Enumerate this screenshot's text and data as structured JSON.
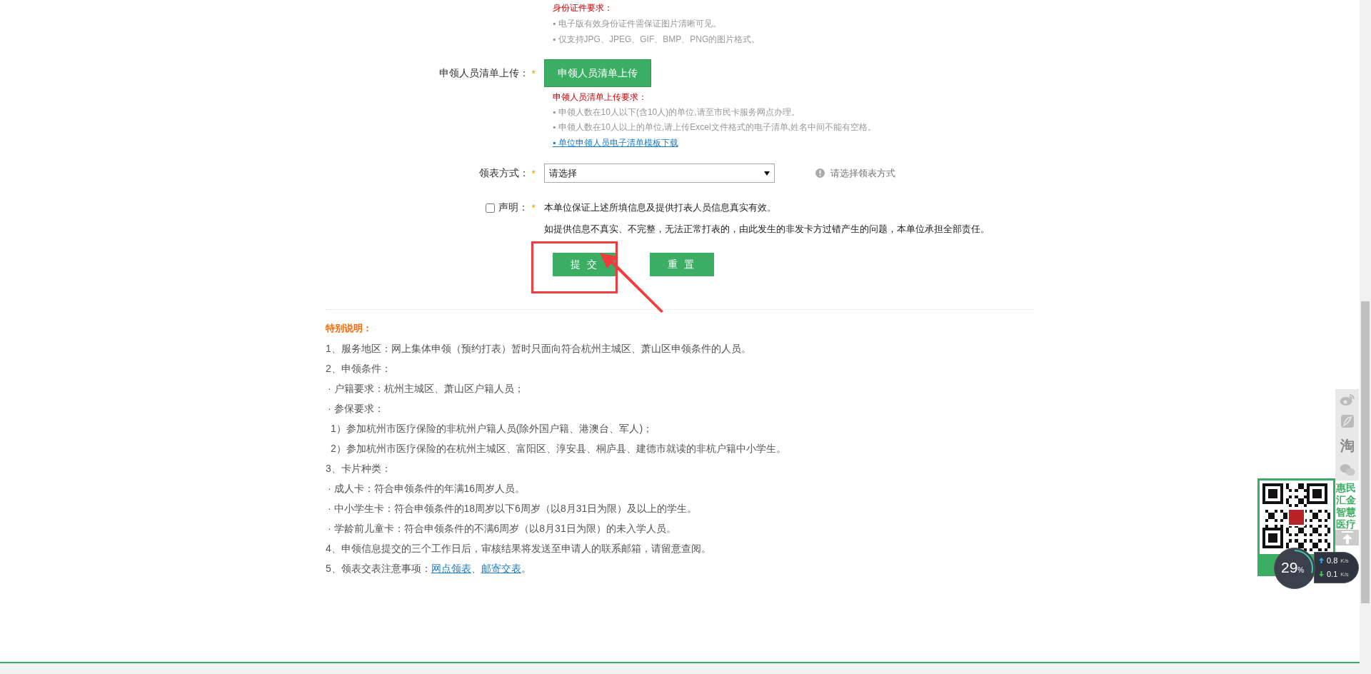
{
  "id_requirements": {
    "title": "身份证件要求：",
    "items": [
      "▪ 电子版有效身份证件需保证图片清晰可见。",
      "▪ 仅支持JPG、JPEG、GIF、BMP、PNG的图片格式。"
    ]
  },
  "list_upload": {
    "label": "申领人员清单上传：",
    "required_mark": "*",
    "button": "申领人员清单上传",
    "requirements_title": "申领人员清单上传要求：",
    "items": [
      "▪ 申领人数在10人以下(含10人)的单位,请至市民卡服务网点办理。",
      "▪ 申领人数在10人以上的单位,请上传Excel文件格式的电子清单,姓名中间不能有空格。"
    ],
    "link": "▪ 单位申领人员电子清单模板下载"
  },
  "pickup_method": {
    "label": "领表方式：",
    "required_mark": "*",
    "select": {
      "value": "请选择"
    },
    "hint": "请选择领表方式"
  },
  "declaration": {
    "checked": false,
    "label": "声明：",
    "required_mark": "*",
    "lines": [
      "本单位保证上述所填信息及提供打表人员信息真实有效。",
      "如提供信息不真实、不完整，无法正常打表的，由此发生的非发卡方过错产生的问题，本单位承担全部责任。"
    ]
  },
  "actions": [
    {
      "label": "提 交"
    },
    {
      "label": "重 置"
    }
  ],
  "notes": {
    "title": "特别说明：",
    "lines": [
      {
        "kind": "item",
        "text": "1、服务地区：网上集体申领（预约打表）暂时只面向符合杭州主城区、萧山区申领条件的人员。"
      },
      {
        "kind": "item",
        "text": "2、申领条件："
      },
      {
        "kind": "sub",
        "text": "· 户籍要求：杭州主城区、萧山区户籍人员；"
      },
      {
        "kind": "sub",
        "text": "· 参保要求："
      },
      {
        "kind": "subsub",
        "text": "1）参加杭州市医疗保险的非杭州户籍人员(除外国户籍、港澳台、军人)；"
      },
      {
        "kind": "subsub",
        "text": "2）参加杭州市医疗保险的在杭州主城区、富阳区、淳安县、桐庐县、建德市就读的非杭户籍中小学生。"
      },
      {
        "kind": "item",
        "text": "3、卡片种类："
      },
      {
        "kind": "sub",
        "text": "· 成人卡：符合申领条件的年满16周岁人员。"
      },
      {
        "kind": "sub",
        "text": "· 中小学生卡：符合申领条件的18周岁以下6周岁（以8月31日为限）及以上的学生。"
      },
      {
        "kind": "sub",
        "text": "· 学龄前儿童卡：符合申领条件的不满6周岁（以8月31日为限）的未入学人员。"
      },
      {
        "kind": "item",
        "text": "4、申领信息提交的三个工作日后，审核结果将发送至申请人的联系邮箱，请留意查阅。"
      },
      {
        "kind": "links",
        "text": "5、领表交表注意事项：",
        "links": [
          "网点领表",
          "邮寄交表"
        ],
        "separator": "、",
        "end": "。"
      }
    ]
  },
  "share_bar": {
    "glyph": "淘",
    "caption": "惠民汇金智慧医疗"
  },
  "speed_widget": {
    "level": 0.29,
    "percent": "29",
    "percent_unit": "%",
    "upload": "0.8",
    "upload_unit": "K/s",
    "download": "0.1",
    "download_unit": "K/s"
  }
}
